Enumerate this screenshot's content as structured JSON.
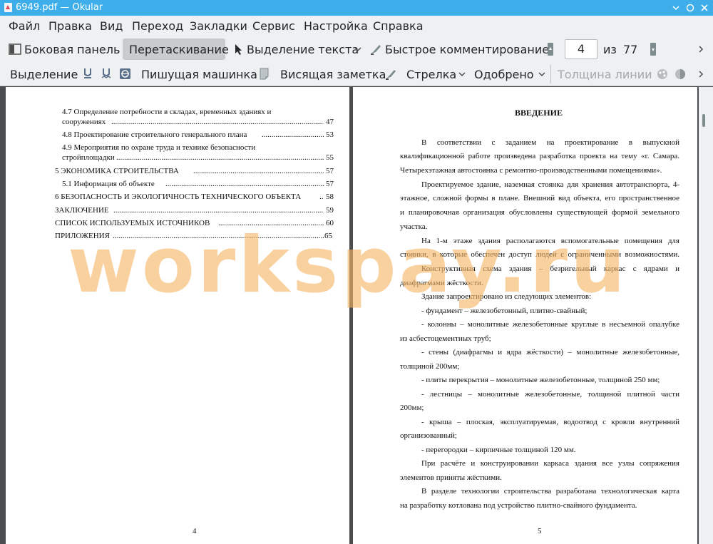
{
  "window": {
    "title": "6949.pdf  — Okular"
  },
  "menu": [
    "Файл",
    "Правка",
    "Вид",
    "Переход",
    "Закладки",
    "Сервис",
    "Настройка",
    "Справка"
  ],
  "toolbar1": {
    "sidebar": "Боковая панель",
    "drag": "Перетаскивание",
    "text_select": "Выделение текста",
    "quick_comment": "Быстрое комментирование",
    "page_current": "4",
    "page_of": "из",
    "page_total": "77"
  },
  "toolbar2": {
    "highlight": "Выделение",
    "typewriter": "Пишущая машинка",
    "sticky_note": "Висящая заметка",
    "arrow": "Стрелка",
    "approved": "Одобрено",
    "line_width": "Толщина линии"
  },
  "left_page": {
    "toc": [
      {
        "l1": "4.7   Определение  потребности в складах, временных зданиях и",
        "l2": "сооружениях",
        "page": "47"
      },
      {
        "l1": "4.8   Проектирование строительного генерального плана",
        "page": "53"
      },
      {
        "l1": "4.9   Мероприятия  по охране  труда  и  технике  безопасности",
        "l2": "стройплощадки",
        "page": "55"
      },
      {
        "l1": "5     ЭКОНОМИКА СТРОИТЕЛЬСТВА",
        "page": "57"
      },
      {
        "l1": "5.1   Информация об объекте",
        "page": "57"
      },
      {
        "l1": "6     БЕЗОПАСНОСТЬ И ЭКОЛОГИЧНОСТЬ ТЕХНИЧЕСКОГО ОБЪЕКТА",
        "page": "58"
      },
      {
        "l1": "ЗАКЛЮЧЕНИЕ",
        "page": "59"
      },
      {
        "l1": "СПИСОК ИСПОЛЬЗУЕМЫХ ИСТОЧНИКОВ",
        "page": "60"
      },
      {
        "l1": "ПРИЛОЖЕНИЯ",
        "page": "65"
      }
    ],
    "page_number": "4"
  },
  "right_page": {
    "heading": "ВВЕДЕНИЕ",
    "lines": [
      "В  соответствии  с  заданием  на  проектирование  в  выпускной",
      "квалификационной работе произведена разработка проекта на тему «г. Самара.",
      "Четырехэтажная автостоянка с ремонтно-производственными помещениями».",
      "Проектируемое здание, наземная стоянка для хранения автотранспорта, 4-",
      "этажное, сложной формы в плане. Внешний вид объекта, его пространственное",
      "и планировочная организация обусловлены существующей формой земельного",
      "участка.",
      "На  1-м  этаже  здания  располагаются  вспомогательные  помещения  для",
      "стоянки, в которые обеспечен доступ людей с ограниченными возможностями.",
      "Конструктивная  схема  здания  –  безригельный  каркас  с  ядрами  и",
      "диафрагмами жёсткости.",
      "Здание запроектировано из следующих элементов:",
      "-  фундамент – железобетонный, плитно-свайный;",
      "-  колонны – монолитные железобетонные круглые в несъемной опалубке",
      "из асбестоцементных труб;",
      "-  стены  (диафрагмы  и  ядра  жёсткости)  –  монолитные  железобетонные,",
      "толщиной 200мм;",
      "-  плиты перекрытия – монолитные железобетонные, толщиной 250 мм;",
      "-  лестницы  –  монолитные  железобетонные,  толщиной  плитной  части",
      "200мм;",
      "-  крыша  –  плоская,  эксплуатируемая,  водоотвод  с  кровли  внутренний",
      "организованный;",
      "-  перегородки – кирпичные толщиной 120 мм.",
      "При  расчёте  и  конструировании  каркаса  здания  все  узлы  сопряжения",
      "элементов приняты жёсткими.",
      "В  разделе  технологии  строительства  разработана  технологическая  карта",
      "на разработку котлована под устройство плитно-свайного фундамента."
    ],
    "page_number": "5"
  },
  "watermark": "workspay.ru",
  "colors": {
    "titlebar": "#3daee9",
    "toolbar": "#eff0f1",
    "watermark": "#f4b464"
  }
}
